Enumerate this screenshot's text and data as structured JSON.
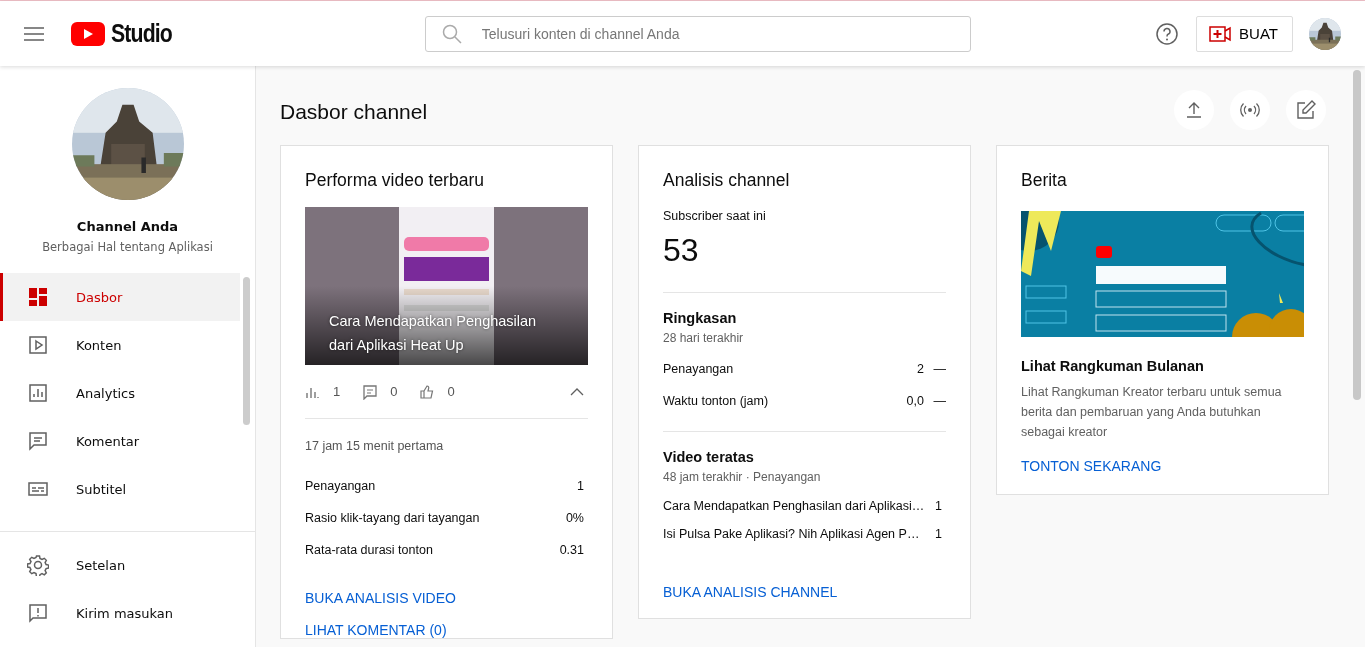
{
  "header": {
    "logo_text": "Studio",
    "search": {
      "placeholder": "Telusuri konten di channel Anda"
    },
    "create_button": "BUAT"
  },
  "sidebar": {
    "channel": {
      "name": "Channel Anda",
      "description": "Berbagai Hal tentang Aplikasi"
    },
    "items": [
      {
        "label": "Dasbor",
        "kind": "dashboard",
        "selected": true
      },
      {
        "label": "Konten",
        "kind": "content",
        "selected": false
      },
      {
        "label": "Analytics",
        "kind": "analytics",
        "selected": false
      },
      {
        "label": "Komentar",
        "kind": "comments",
        "selected": false
      },
      {
        "label": "Subtitel",
        "kind": "subtitles",
        "selected": false
      }
    ],
    "footer_items": [
      {
        "label": "Setelan",
        "kind": "settings"
      },
      {
        "label": "Kirim masukan",
        "kind": "feedback"
      }
    ]
  },
  "page_title": "Dasbor channel",
  "performance": {
    "title": "Performa video terbaru",
    "video_title": "Cara Mendapatkan Penghasilan dari Aplikasi Heat Up",
    "stats": [
      {
        "kind": "views",
        "value": "1"
      },
      {
        "kind": "comments",
        "value": "0"
      },
      {
        "kind": "likes",
        "value": "0"
      }
    ],
    "period": "17 jam 15 menit pertama",
    "metrics": [
      {
        "label": "Penayangan",
        "value": "1"
      },
      {
        "label": "Rasio klik-tayang dari tayangan",
        "value": "0%"
      },
      {
        "label": "Rata-rata durasi tonton",
        "value": "0.31"
      }
    ],
    "links": [
      "BUKA ANALISIS VIDEO",
      "LIHAT KOMENTAR (0)"
    ]
  },
  "analytics": {
    "title": "Analisis channel",
    "subscriber_label": "Subscriber saat ini",
    "subscriber_count": "53",
    "summary": {
      "title": "Ringkasan",
      "period": "28 hari terakhir",
      "rows": [
        {
          "label": "Penayangan",
          "value": "2",
          "trend": "—"
        },
        {
          "label": "Waktu tonton (jam)",
          "value": "0,0",
          "trend": "—"
        }
      ]
    },
    "top_videos": {
      "title": "Video teratas",
      "period": "48 jam terakhir · Penayangan",
      "rows": [
        {
          "title": "Cara Mendapatkan Penghasilan dari Aplikasi…",
          "value": "1"
        },
        {
          "title": "Isi Pulsa Pake Aplikasi? Nih Aplikasi Agen P…",
          "value": "1"
        }
      ]
    },
    "link": "BUKA ANALISIS CHANNEL"
  },
  "news": {
    "title": "Berita",
    "headline": "Lihat Rangkuman Bulanan",
    "body": "Lihat Rangkuman Kreator terbaru untuk semua berita dan pembaruan yang Anda butuhkan sebagai kreator",
    "link": "TONTON SEKARANG"
  }
}
